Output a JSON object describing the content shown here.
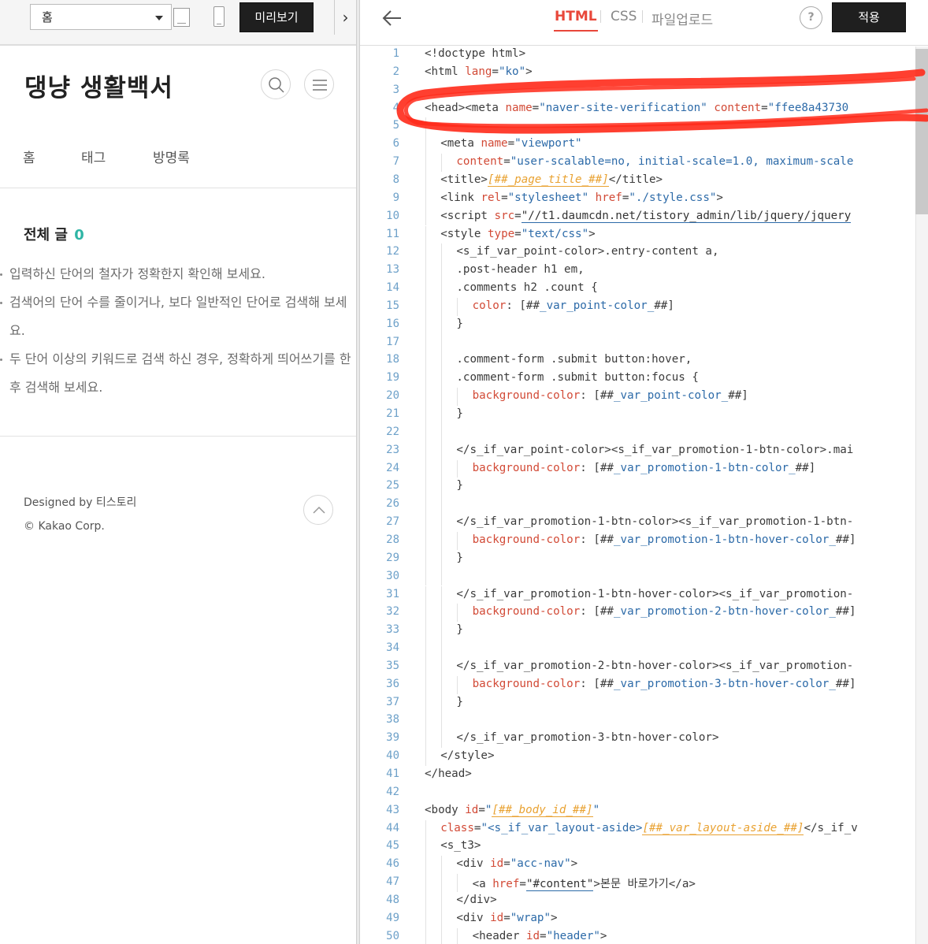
{
  "preview": {
    "page_select": "홈",
    "preview_button": "미리보기",
    "collapse_glyph": "›",
    "blog_title": "댕냥 생활백서",
    "nav": [
      "홈",
      "태그",
      "방명록"
    ],
    "posts_heading": "전체 글",
    "posts_count": "0",
    "tips": [
      "입력하신 단어의 철자가 정확한지 확인해 보세요.",
      "검색어의 단어 수를 줄이거나, 보다 일반적인 단어로 검색해 보세요.",
      "두 단어 이상의 키워드로 검색 하신 경우, 정확하게 띄어쓰기를 한 후 검색해 보세요."
    ],
    "footer_designed": "Designed by 티스토리",
    "footer_copyright": "© Kakao Corp."
  },
  "editor": {
    "tabs": [
      "HTML",
      "CSS",
      "파일업로드"
    ],
    "help": "?",
    "apply_button": "적용",
    "accent_color": "#e8473a",
    "annotation_color": "#ff2a1a"
  },
  "code_lines": [
    [
      [
        "t",
        "<!doctype html>"
      ]
    ],
    [
      [
        "t",
        "<html "
      ],
      [
        "a",
        "lang"
      ],
      [
        "t",
        "="
      ],
      [
        "s",
        "\"ko\""
      ],
      [
        "t",
        ">"
      ]
    ],
    [],
    [
      [
        "t",
        "<head><meta "
      ],
      [
        "a",
        "name"
      ],
      [
        "t",
        "="
      ],
      [
        "s",
        "\"naver-site-verification\""
      ],
      [
        "t",
        " "
      ],
      [
        "a",
        "content"
      ],
      [
        "t",
        "="
      ],
      [
        "s",
        "\"ffee8a43730"
      ]
    ],
    [],
    [
      [
        "t",
        "<meta "
      ],
      [
        "a",
        "name"
      ],
      [
        "t",
        "="
      ],
      [
        "s",
        "\"viewport\""
      ]
    ],
    [
      [
        "a",
        "content"
      ],
      [
        "t",
        "="
      ],
      [
        "s",
        "\"user-scalable=no, initial-scale=1.0, maximum-scale"
      ]
    ],
    [
      [
        "t",
        "<title>"
      ],
      [
        "v",
        "[##_page_title_##]"
      ],
      [
        "t",
        "</title>"
      ]
    ],
    [
      [
        "t",
        "<link "
      ],
      [
        "a",
        "rel"
      ],
      [
        "t",
        "="
      ],
      [
        "s",
        "\"stylesheet\""
      ],
      [
        "t",
        " "
      ],
      [
        "a",
        "href"
      ],
      [
        "t",
        "="
      ],
      [
        "s",
        "\"./style.css\""
      ],
      [
        "t",
        ">"
      ]
    ],
    [
      [
        "t",
        "<script "
      ],
      [
        "a",
        "src"
      ],
      [
        "t",
        "="
      ],
      [
        "u",
        "\"//t1.daumcdn.net/tistory_admin/lib/jquery/jquery"
      ]
    ],
    [
      [
        "t",
        "<style "
      ],
      [
        "a",
        "type"
      ],
      [
        "t",
        "="
      ],
      [
        "s",
        "\"text/css\""
      ],
      [
        "t",
        ">"
      ]
    ],
    [
      [
        "t",
        "<s_if_var_point-color>.entry-content a,"
      ]
    ],
    [
      [
        "t",
        ".post-header h1 em,"
      ]
    ],
    [
      [
        "t",
        ".comments h2 .count {"
      ]
    ],
    [
      [
        "a",
        "color"
      ],
      [
        "t",
        ": [##"
      ],
      [
        "s",
        "_var_point-color_"
      ],
      [
        "t",
        "##]"
      ]
    ],
    [
      [
        "t",
        "}"
      ]
    ],
    [],
    [
      [
        "t",
        ".comment-form .submit button:hover,"
      ]
    ],
    [
      [
        "t",
        ".comment-form .submit button:focus {"
      ]
    ],
    [
      [
        "a",
        "background-color"
      ],
      [
        "t",
        ": [##"
      ],
      [
        "s",
        "_var_point-color_"
      ],
      [
        "t",
        "##]"
      ]
    ],
    [
      [
        "t",
        "}"
      ]
    ],
    [],
    [
      [
        "t",
        "</s_if_var_point-color><s_if_var_promotion-1-btn-color>.mai"
      ]
    ],
    [
      [
        "a",
        "background-color"
      ],
      [
        "t",
        ": [##"
      ],
      [
        "s",
        "_var_promotion-1-btn-color_"
      ],
      [
        "t",
        "##]"
      ]
    ],
    [
      [
        "t",
        "}"
      ]
    ],
    [],
    [
      [
        "t",
        "</s_if_var_promotion-1-btn-color><s_if_var_promotion-1-btn-"
      ]
    ],
    [
      [
        "a",
        "background-color"
      ],
      [
        "t",
        ": [##"
      ],
      [
        "s",
        "_var_promotion-1-btn-hover-color_"
      ],
      [
        "t",
        "##]"
      ]
    ],
    [
      [
        "t",
        "}"
      ]
    ],
    [],
    [
      [
        "t",
        "</s_if_var_promotion-1-btn-hover-color><s_if_var_promotion-"
      ]
    ],
    [
      [
        "a",
        "background-color"
      ],
      [
        "t",
        ": [##"
      ],
      [
        "s",
        "_var_promotion-2-btn-hover-color_"
      ],
      [
        "t",
        "##]"
      ]
    ],
    [
      [
        "t",
        "}"
      ]
    ],
    [],
    [
      [
        "t",
        "</s_if_var_promotion-2-btn-hover-color><s_if_var_promotion-"
      ]
    ],
    [
      [
        "a",
        "background-color"
      ],
      [
        "t",
        ": [##"
      ],
      [
        "s",
        "_var_promotion-3-btn-hover-color_"
      ],
      [
        "t",
        "##]"
      ]
    ],
    [
      [
        "t",
        "}"
      ]
    ],
    [],
    [
      [
        "t",
        "</s_if_var_promotion-3-btn-hover-color>"
      ]
    ],
    [
      [
        "t",
        "</style>"
      ]
    ],
    [
      [
        "t",
        "</head>"
      ]
    ],
    [],
    [
      [
        "t",
        "<body "
      ],
      [
        "a",
        "id"
      ],
      [
        "t",
        "="
      ],
      [
        "s",
        "\""
      ],
      [
        "v",
        "[##_body_id_##]"
      ],
      [
        "s",
        "\""
      ]
    ],
    [
      [
        "a",
        "class"
      ],
      [
        "t",
        "="
      ],
      [
        "s",
        "\"<s_if_var_layout-aside>"
      ],
      [
        "v",
        "[##_var_layout-aside_##]"
      ],
      [
        "t",
        "</s_if_v"
      ]
    ],
    [
      [
        "t",
        "<s_t3>"
      ]
    ],
    [
      [
        "t",
        "<div "
      ],
      [
        "a",
        "id"
      ],
      [
        "t",
        "="
      ],
      [
        "s",
        "\"acc-nav\""
      ],
      [
        "t",
        ">"
      ]
    ],
    [
      [
        "t",
        "<a "
      ],
      [
        "a",
        "href"
      ],
      [
        "t",
        "="
      ],
      [
        "u",
        "\"#content\""
      ],
      [
        "t",
        ">본문 바로가기</a>"
      ]
    ],
    [
      [
        "t",
        "</div>"
      ]
    ],
    [
      [
        "t",
        "<div "
      ],
      [
        "a",
        "id"
      ],
      [
        "t",
        "="
      ],
      [
        "s",
        "\"wrap\""
      ],
      [
        "t",
        ">"
      ]
    ],
    [
      [
        "t",
        "<header "
      ],
      [
        "a",
        "id"
      ],
      [
        "t",
        "="
      ],
      [
        "s",
        "\"header\""
      ],
      [
        "t",
        ">"
      ]
    ]
  ]
}
